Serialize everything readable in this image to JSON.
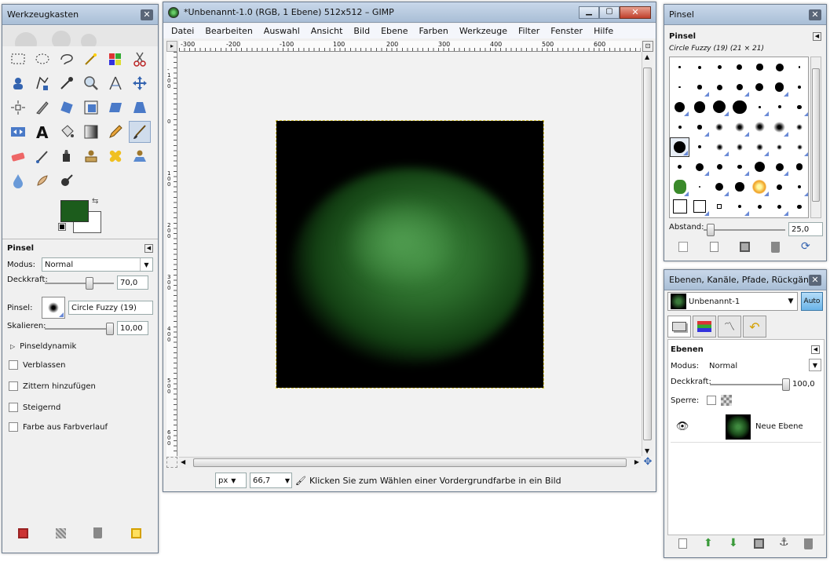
{
  "toolbox": {
    "title": "Werkzeugkasten",
    "fg_color": "#1c5c1c",
    "bg_color": "#ffffff",
    "options": {
      "title": "Pinsel",
      "mode_label": "Modus:",
      "mode_value": "Normal",
      "opacity_label": "Deckkraft:",
      "opacity_value": "70,0",
      "opacity_fraction": 0.7,
      "brush_label": "Pinsel:",
      "brush_value": "Circle Fuzzy (19)",
      "scale_label": "Skalieren:",
      "scale_value": "10,00",
      "scale_fraction": 1.0,
      "dynamics_label": "Pinseldynamik",
      "checkboxes": [
        "Verblassen",
        "Zittern hinzufügen",
        "Steigernd",
        "Farbe aus Farbverlauf"
      ]
    }
  },
  "main": {
    "title": "*Unbenannt-1.0 (RGB, 1 Ebene) 512x512 – GIMP",
    "menu": [
      "Datei",
      "Bearbeiten",
      "Auswahl",
      "Ansicht",
      "Bild",
      "Ebene",
      "Farben",
      "Werkzeuge",
      "Filter",
      "Fenster",
      "Hilfe"
    ],
    "ruler_h": [
      "-300",
      "-200",
      "-100",
      "0",
      "100",
      "200",
      "300",
      "400",
      "500",
      "600"
    ],
    "ruler_v": [
      "-100",
      "0",
      "100",
      "200",
      "300",
      "400",
      "500",
      "600"
    ],
    "unit": "px",
    "zoom": "66,7",
    "status": "Klicken Sie zum Wählen einer Vordergrundfarbe in ein Bild"
  },
  "brushes": {
    "title": "Pinsel",
    "section": "Pinsel",
    "current": "Circle Fuzzy (19) (21 × 21)",
    "spacing_label": "Abstand:",
    "spacing_value": "25,0",
    "spacing_fraction": 0.25
  },
  "layers": {
    "title": "Ebenen, Kanäle, Pfade, Rückgän...",
    "image_name": "Unbenannt-1",
    "auto_label": "Auto",
    "section": "Ebenen",
    "mode_label": "Modus:",
    "mode_value": "Normal",
    "opacity_label": "Deckkraft:",
    "opacity_value": "100,0",
    "opacity_fraction": 1.0,
    "lock_label": "Sperre:",
    "layer_name": "Neue Ebene"
  }
}
